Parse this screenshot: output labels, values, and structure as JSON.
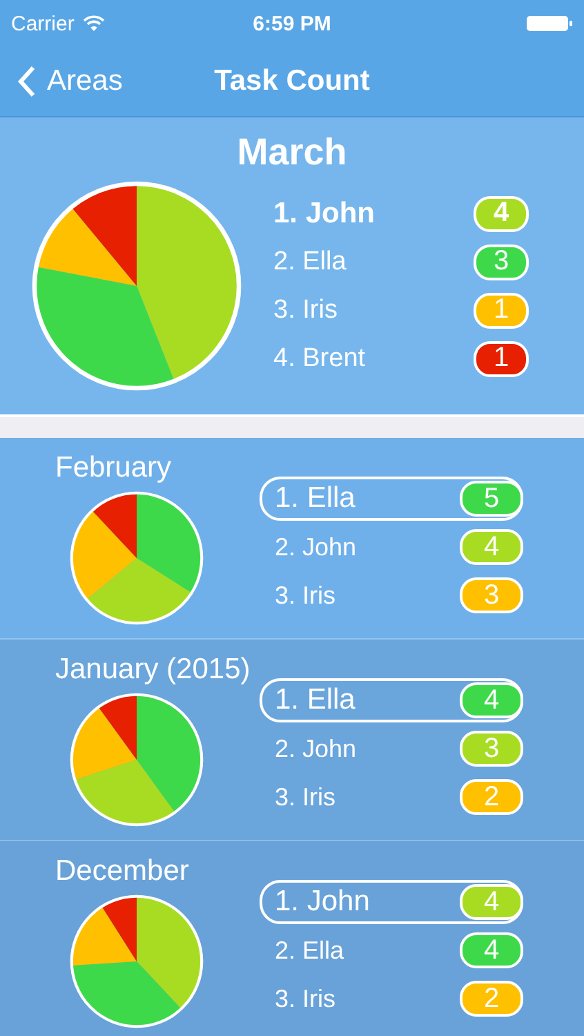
{
  "status_bar": {
    "carrier": "Carrier",
    "time": "6:59 PM"
  },
  "nav": {
    "back": "Areas",
    "title": "Task Count"
  },
  "months": [
    {
      "kind": "featured",
      "title": "March",
      "rows": [
        {
          "label": "1. John",
          "count": "4",
          "color": "#a8dc22",
          "leader": true
        },
        {
          "label": "2. Ella",
          "count": "3",
          "color": "#3ed94a",
          "leader": false
        },
        {
          "label": "3. Iris",
          "count": "1",
          "color": "#ffc000",
          "leader": false
        },
        {
          "label": "4. Brent",
          "count": "1",
          "color": "#e62000",
          "leader": false
        }
      ]
    },
    {
      "kind": "compact",
      "title": "February",
      "rows": [
        {
          "label": "1. Ella",
          "count": "5",
          "color": "#3ed94a",
          "leader": true
        },
        {
          "label": "2. John",
          "count": "4",
          "color": "#a8dc22",
          "leader": false
        },
        {
          "label": "3. Iris",
          "count": "3",
          "color": "#ffc000",
          "leader": false
        }
      ]
    },
    {
      "kind": "compact",
      "title": "January (2015)",
      "rows": [
        {
          "label": "1. Ella",
          "count": "4",
          "color": "#3ed94a",
          "leader": true
        },
        {
          "label": "2. John",
          "count": "3",
          "color": "#a8dc22",
          "leader": false
        },
        {
          "label": "3. Iris",
          "count": "2",
          "color": "#ffc000",
          "leader": false
        }
      ]
    },
    {
      "kind": "compact",
      "title": "December",
      "rows": [
        {
          "label": "1. John",
          "count": "4",
          "color": "#a8dc22",
          "leader": true
        },
        {
          "label": "2. Ella",
          "count": "4",
          "color": "#3ed94a",
          "leader": false
        },
        {
          "label": "3. Iris",
          "count": "2",
          "color": "#ffc000",
          "leader": false
        }
      ]
    }
  ]
}
